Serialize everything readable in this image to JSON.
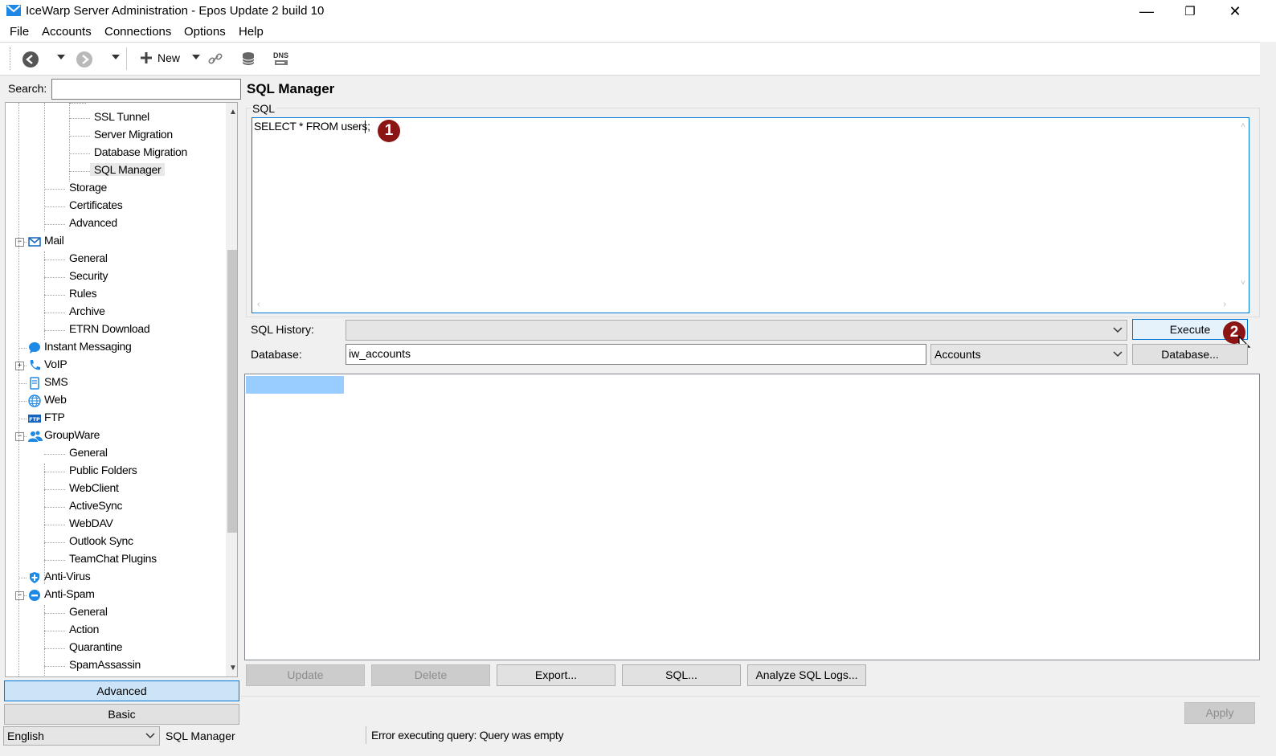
{
  "window": {
    "title": "IceWarp Server Administration - Epos Update 2 build 10",
    "controls": [
      "—",
      "❐",
      "✕"
    ]
  },
  "menu": [
    "File",
    "Accounts",
    "Connections",
    "Options",
    "Help"
  ],
  "toolbar": {
    "new_label": "New",
    "dns_label": "DNS"
  },
  "search": {
    "label": "Search:",
    "value": ""
  },
  "tree": {
    "nodes": [
      {
        "label": "SSL Tunnel",
        "level": 3,
        "icon": "none"
      },
      {
        "label": "Server Migration",
        "level": 3,
        "icon": "none"
      },
      {
        "label": "Database Migration",
        "level": 3,
        "icon": "none"
      },
      {
        "label": "SQL Manager",
        "level": 3,
        "icon": "none",
        "selected": true
      },
      {
        "label": "Storage",
        "level": 2,
        "icon": "none"
      },
      {
        "label": "Certificates",
        "level": 2,
        "icon": "none"
      },
      {
        "label": "Advanced",
        "level": 2,
        "icon": "none"
      },
      {
        "label": "Mail",
        "level": 1,
        "icon": "mail-icon",
        "expander": "−"
      },
      {
        "label": "General",
        "level": 2,
        "icon": "none"
      },
      {
        "label": "Security",
        "level": 2,
        "icon": "none"
      },
      {
        "label": "Rules",
        "level": 2,
        "icon": "none"
      },
      {
        "label": "Archive",
        "level": 2,
        "icon": "none"
      },
      {
        "label": "ETRN Download",
        "level": 2,
        "icon": "none"
      },
      {
        "label": "Instant Messaging",
        "level": 1,
        "icon": "chat-bubble-icon"
      },
      {
        "label": "VoIP",
        "level": 1,
        "icon": "phone-icon",
        "expander": "+"
      },
      {
        "label": "SMS",
        "level": 1,
        "icon": "sms-icon"
      },
      {
        "label": "Web",
        "level": 1,
        "icon": "globe-icon"
      },
      {
        "label": "FTP",
        "level": 1,
        "icon": "ftp-icon"
      },
      {
        "label": "GroupWare",
        "level": 1,
        "icon": "users-icon",
        "expander": "−"
      },
      {
        "label": "General",
        "level": 2,
        "icon": "none"
      },
      {
        "label": "Public Folders",
        "level": 2,
        "icon": "none"
      },
      {
        "label": "WebClient",
        "level": 2,
        "icon": "none"
      },
      {
        "label": "ActiveSync",
        "level": 2,
        "icon": "none"
      },
      {
        "label": "WebDAV",
        "level": 2,
        "icon": "none"
      },
      {
        "label": "Outlook Sync",
        "level": 2,
        "icon": "none"
      },
      {
        "label": "TeamChat Plugins",
        "level": 2,
        "icon": "none"
      },
      {
        "label": "Anti-Virus",
        "level": 1,
        "icon": "shield-icon"
      },
      {
        "label": "Anti-Spam",
        "level": 1,
        "icon": "no-entry-icon",
        "expander": "−"
      },
      {
        "label": "General",
        "level": 2,
        "icon": "none"
      },
      {
        "label": "Action",
        "level": 2,
        "icon": "none"
      },
      {
        "label": "Quarantine",
        "level": 2,
        "icon": "none"
      },
      {
        "label": "SpamAssassin",
        "level": 2,
        "icon": "none"
      }
    ]
  },
  "mode_buttons": {
    "advanced": "Advanced",
    "basic": "Basic"
  },
  "page": {
    "title": "SQL Manager",
    "sql_group_label": "SQL",
    "sql_text": "SELECT * FROM users;"
  },
  "markers": [
    "1",
    "2"
  ],
  "history": {
    "label": "SQL History:",
    "value": ""
  },
  "database": {
    "label": "Database:",
    "value": "iw_accounts",
    "type": "Accounts"
  },
  "buttons": {
    "execute": "Execute",
    "database": "Database...",
    "update": "Update",
    "delete": "Delete",
    "export": "Export...",
    "sql": "SQL...",
    "analyze": "Analyze SQL Logs...",
    "apply": "Apply"
  },
  "status": {
    "language": "English",
    "section": "SQL Manager",
    "message": "Error executing query: Query was empty"
  },
  "colors": {
    "accent": "#0078d7",
    "marker": "#8b1414",
    "selection": "#99ccff"
  }
}
